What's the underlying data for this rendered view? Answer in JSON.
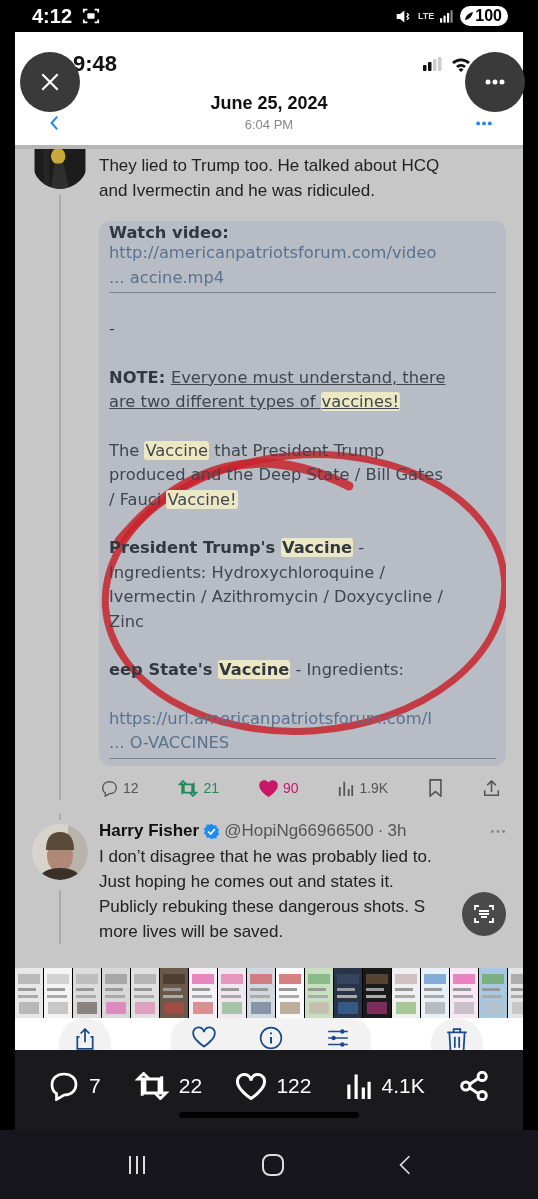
{
  "status_bar": {
    "time": "4:12",
    "network": "LTE",
    "battery": "100"
  },
  "screenshot": {
    "status_time": "9:48",
    "header": {
      "date": "June 25, 2024",
      "time": "6:04 PM"
    },
    "tweet": {
      "lines": [
        "They lied to Trump too. He talked about HCQ",
        "and Ivermectin and he was ridiculed."
      ],
      "image": {
        "paragraphs": [
          {
            "kind": "heading",
            "lines": [
              [
                {
                  "text": "Watch video:",
                  "bold": true
                }
              ]
            ]
          },
          {
            "kind": "link",
            "lines": [
              [
                {
                  "text": "http://americanpatriotsforum.com/video"
                }
              ],
              [
                {
                  "text": "... accine.mp4"
                }
              ]
            ]
          },
          {
            "kind": "text",
            "lines": [
              [
                {
                  "text": "-"
                }
              ]
            ]
          },
          {
            "kind": "text",
            "lines": [
              [
                {
                  "text": "NOTE: ",
                  "bold": true
                },
                {
                  "text": "Everyone must understand, there",
                  "underline": true
                }
              ],
              [
                {
                  "text": "are two different types of ",
                  "underline": true
                },
                {
                  "text": "vaccines!",
                  "underline": true,
                  "highlight": true
                }
              ]
            ]
          },
          {
            "kind": "text",
            "lines": [
              [
                {
                  "text": "The "
                },
                {
                  "text": "Vaccine",
                  "highlight": true
                },
                {
                  "text": " that President Trump"
                }
              ],
              [
                {
                  "text": "produced and the Deep State / Bill Gates"
                }
              ],
              [
                {
                  "text": "/ Fauci "
                },
                {
                  "text": "Vaccine!",
                  "highlight": true
                }
              ]
            ]
          },
          {
            "kind": "text",
            "lines": [
              [
                {
                  "text": "President Trump's ",
                  "bold": true
                },
                {
                  "text": "Vaccine",
                  "bold": true,
                  "highlight": true
                },
                {
                  "text": " -"
                }
              ],
              [
                {
                  "text": "Ingredients: Hydroxychloroquine /"
                }
              ],
              [
                {
                  "text": "Ivermectin / Azithromycin / Doxycycline /"
                }
              ],
              [
                {
                  "text": "Zinc"
                }
              ]
            ]
          },
          {
            "kind": "text",
            "lines": [
              [
                {
                  "text": "eep State's ",
                  "bold": true
                },
                {
                  "text": "Vaccine",
                  "bold": true,
                  "highlight": true
                },
                {
                  "text": " - Ingredients:"
                }
              ]
            ]
          },
          {
            "kind": "link",
            "lines": [
              [
                {
                  "text": "https://url.americanpatriotsforum.com/I"
                }
              ],
              [
                {
                  "text": "... O-VACCINES"
                }
              ]
            ]
          }
        ]
      },
      "actions": [
        {
          "kind": "reply",
          "count": "12"
        },
        {
          "kind": "repost",
          "count": "21",
          "active": true
        },
        {
          "kind": "like",
          "count": "90",
          "active": true
        },
        {
          "kind": "views",
          "count": "1.9K"
        },
        {
          "kind": "bookmark"
        },
        {
          "kind": "share"
        }
      ]
    },
    "reply": {
      "name": "Harry Fisher",
      "verified": true,
      "handle": "@HopiNg66966500",
      "separator": "·",
      "age": "3h",
      "lines": [
        "I don’t disagree that he was probably lied to.",
        "Just hoping he comes out and states it.",
        "Publicly rebuking these dangerous shots. S",
        "more lives will be saved."
      ]
    }
  },
  "bottom_actions": [
    {
      "kind": "reply",
      "count": "7"
    },
    {
      "kind": "repost",
      "count": "22"
    },
    {
      "kind": "like",
      "count": "122"
    },
    {
      "kind": "views",
      "count": "4.1K"
    },
    {
      "kind": "share"
    }
  ]
}
